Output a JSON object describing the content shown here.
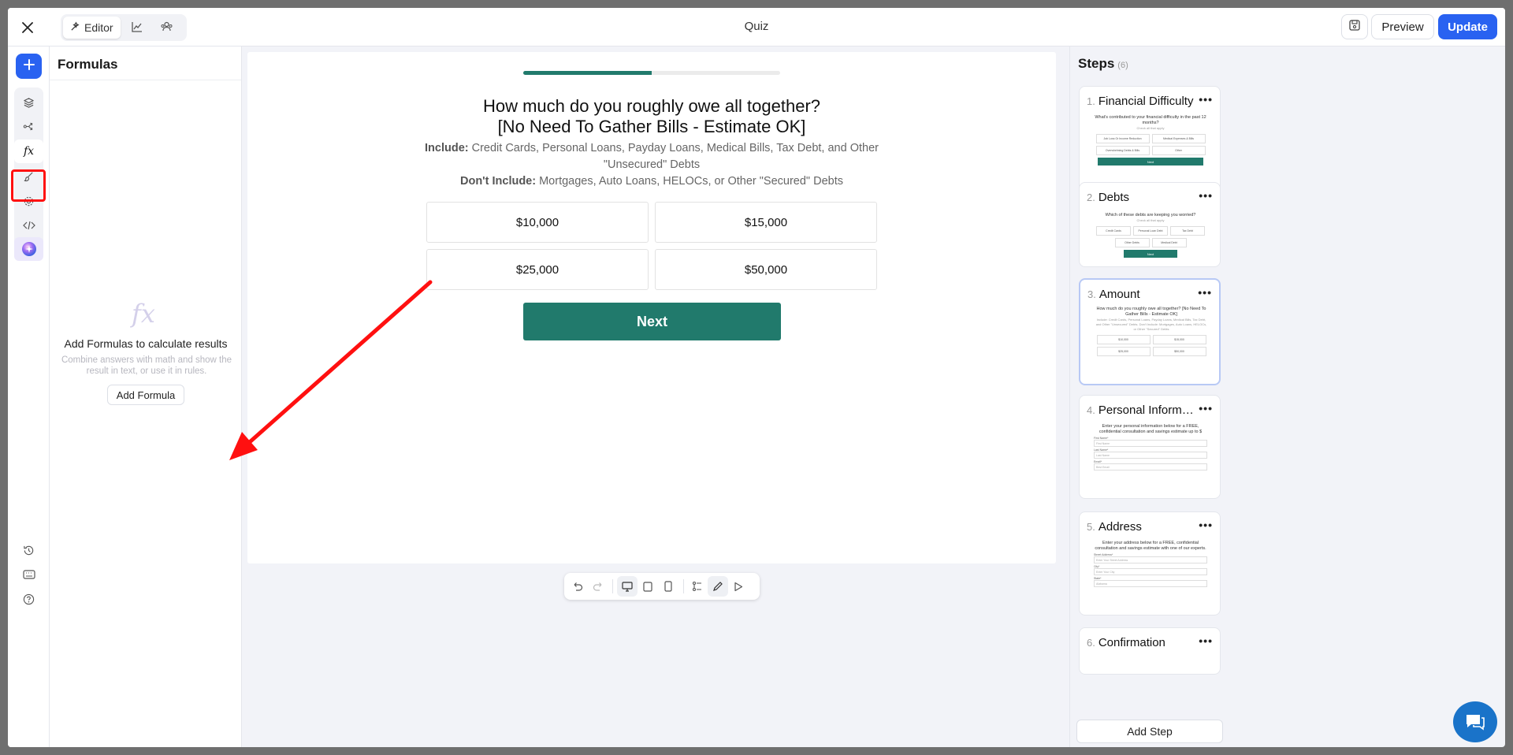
{
  "topbar": {
    "tabs": [
      {
        "label": "Editor",
        "icon": "wand-icon"
      },
      {
        "label": "",
        "icon": "chart-icon"
      },
      {
        "label": "",
        "icon": "users-icon"
      }
    ],
    "title": "Quiz",
    "preview_label": "Preview",
    "update_label": "Update"
  },
  "rail": {
    "items": [
      "layers-icon",
      "branch-icon",
      "formula-icon",
      "brush-icon",
      "settings-icon",
      "code-icon",
      "ai-orb-icon"
    ],
    "bottom": [
      "history-icon",
      "keyboard-icon",
      "help-icon"
    ]
  },
  "formulas": {
    "title": "Formulas",
    "empty_icon_text": "fx",
    "empty_title": "Add Formulas to calculate results",
    "empty_desc": "Combine answers with math and show the result in text, or use it in rules.",
    "add_label": "Add Formula"
  },
  "canvas": {
    "progress": 0.5,
    "question_line1": "How much do you roughly owe all together?",
    "question_line2": "[No Need To Gather Bills - Estimate OK]",
    "include_label": "Include:",
    "include_text": " Credit Cards, Personal Loans, Payday Loans, Medical Bills, Tax Debt, and Other \"Unsecured\" Debts",
    "exclude_label": "Don't Include:",
    "exclude_text": " Mortgages, Auto Loans, HELOCs, or Other \"Secured\" Debts",
    "options": [
      "$10,000",
      "$15,000",
      "$25,000",
      "$50,000"
    ],
    "next_label": "Next"
  },
  "steps": {
    "title": "Steps",
    "count": "(6)",
    "items": [
      {
        "num": "1.",
        "title": "Financial Difficulty",
        "thumb_q": "What's contributed to your financial difficulty in the past 12 months?",
        "thumb_sub": "Check all that apply",
        "thumb_opts": [
          "Job Loss Or Income Reduction",
          "Medical Expenses & Bills",
          "Overwhelming Debts & Bills",
          "Other"
        ],
        "thumb_next": "Next"
      },
      {
        "num": "2.",
        "title": "Debts",
        "thumb_q": "Which of these debts are keeping you worried?",
        "thumb_sub": "Check all that apply",
        "thumb_opts": [
          "Credit Cards",
          "Personal Loan Debt",
          "Tax Debt",
          "Other Debts",
          "Medical Debt"
        ],
        "thumb_next": "Next"
      },
      {
        "num": "3.",
        "title": "Amount",
        "thumb_q": "How much do you roughly owe all together? [No Need To Gather Bills - Estimate OK]",
        "thumb_sub": "Include: Credit Cards, Personal Loans, Payday Loans, Medical Bills, Tax Debt, and Other \"Unsecured\" Debts. Don't Include: Mortgages, Auto Loans, HELOCs, or Other \"Secured\" Debts",
        "thumb_opts": [
          "$10,000",
          "$15,000",
          "$25,000",
          "$50,000"
        ]
      },
      {
        "num": "4.",
        "title": "Personal Informati...",
        "thumb_q": "Enter your personal information below for a FREE, confidential consultation and savings estimate up to $",
        "fields": [
          [
            "First Name*",
            "First Name"
          ],
          [
            "Last Name*",
            "Last Name"
          ],
          [
            "Email*",
            "Best Email"
          ]
        ]
      },
      {
        "num": "5.",
        "title": "Address",
        "thumb_q": "Enter your address below for a FREE, confidential consultation and savings estimate with one of our experts.",
        "fields": [
          [
            "Street Address*",
            "Enter Your Street Address"
          ],
          [
            "City*",
            "Enter Your City"
          ],
          [
            "State*",
            "Alabama"
          ]
        ]
      },
      {
        "num": "6.",
        "title": "Confirmation"
      }
    ],
    "add_label": "Add Step"
  }
}
